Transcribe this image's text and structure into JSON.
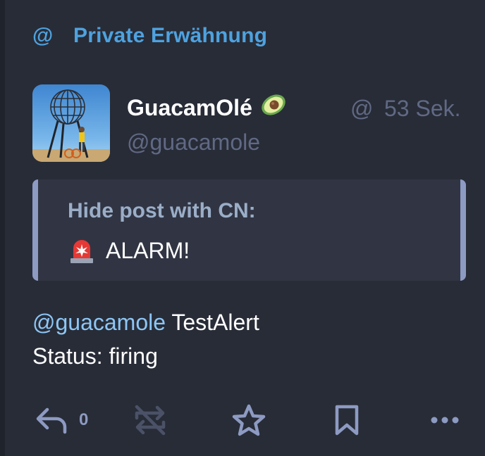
{
  "prepend": {
    "icon": "at-icon",
    "label": "Private Erwähnung"
  },
  "status": {
    "display_name": "GuacamOlé",
    "name_emoji": "avocado-icon",
    "account": "@guacamole",
    "visibility_icon": "@",
    "relative_time": "53 Sek.",
    "cw": {
      "hint": "Hide post with CN:",
      "title": "ALARM!",
      "title_icon": "siren-icon"
    },
    "content": {
      "mention": "@guacamole",
      "line1_rest": " TestAlert",
      "line2": "Status: firing"
    }
  },
  "actions": {
    "reply_count": "0",
    "icons": [
      "reply-icon",
      "reblog-icon",
      "star-icon",
      "bookmark-icon",
      "more-icon"
    ]
  },
  "colors": {
    "background": "#282c37",
    "accent": "#4ea2df",
    "muted": "#606984",
    "mention": "#8cc6f5",
    "action": "#8d9ac2"
  }
}
